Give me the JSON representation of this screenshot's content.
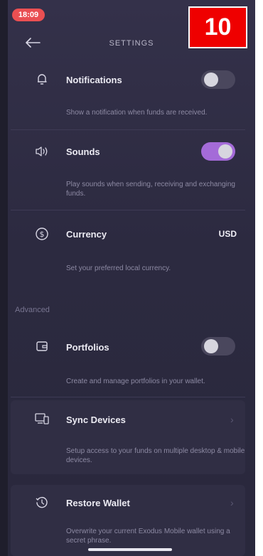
{
  "status": {
    "time": "18:09"
  },
  "badge": {
    "number": "10"
  },
  "header": {
    "title": "SETTINGS"
  },
  "settings": {
    "notifications": {
      "label": "Notifications",
      "description": "Show a notification when funds are received.",
      "enabled": false
    },
    "sounds": {
      "label": "Sounds",
      "description": "Play sounds when sending, receiving and exchanging funds.",
      "enabled": true
    },
    "currency": {
      "label": "Currency",
      "value": "USD",
      "description": "Set your preferred local currency."
    }
  },
  "advanced": {
    "section_label": "Advanced",
    "portfolios": {
      "label": "Portfolios",
      "description": "Create and manage portfolios in your wallet.",
      "enabled": false
    },
    "sync_devices": {
      "label": "Sync Devices",
      "description": "Setup access to your funds on multiple desktop & mobile devices."
    },
    "restore_wallet": {
      "label": "Restore Wallet",
      "description": "Overwrite your current Exodus Mobile wallet using a secret phrase."
    }
  },
  "colors": {
    "accent": "#a46bd8",
    "background": "#2d2b41",
    "badge": "#ef0000",
    "status_pill": "#ea4f52"
  },
  "icons": [
    "back-arrow-icon",
    "bell-icon",
    "speaker-icon",
    "dollar-circle-icon",
    "wallet-icon",
    "devices-icon",
    "restore-icon",
    "chevron-right-icon"
  ]
}
